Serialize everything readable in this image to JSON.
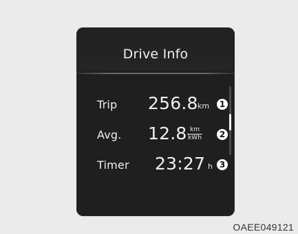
{
  "screen": {
    "title": "Drive Info"
  },
  "rows": [
    {
      "label": "Trip",
      "value": "256.8",
      "unit": "km",
      "callout": "1"
    },
    {
      "label": "Avg.",
      "value": "12.8",
      "unit_numerator": "km",
      "unit_denominator": "kWh",
      "callout": "2"
    },
    {
      "label": "Timer",
      "value": "23:27",
      "unit": "h",
      "callout": "3"
    }
  ],
  "caption": "OAEE049121",
  "colors": {
    "background": "#ebebeb",
    "panel": "#1f1f1f",
    "text": "#f0f0f0"
  }
}
